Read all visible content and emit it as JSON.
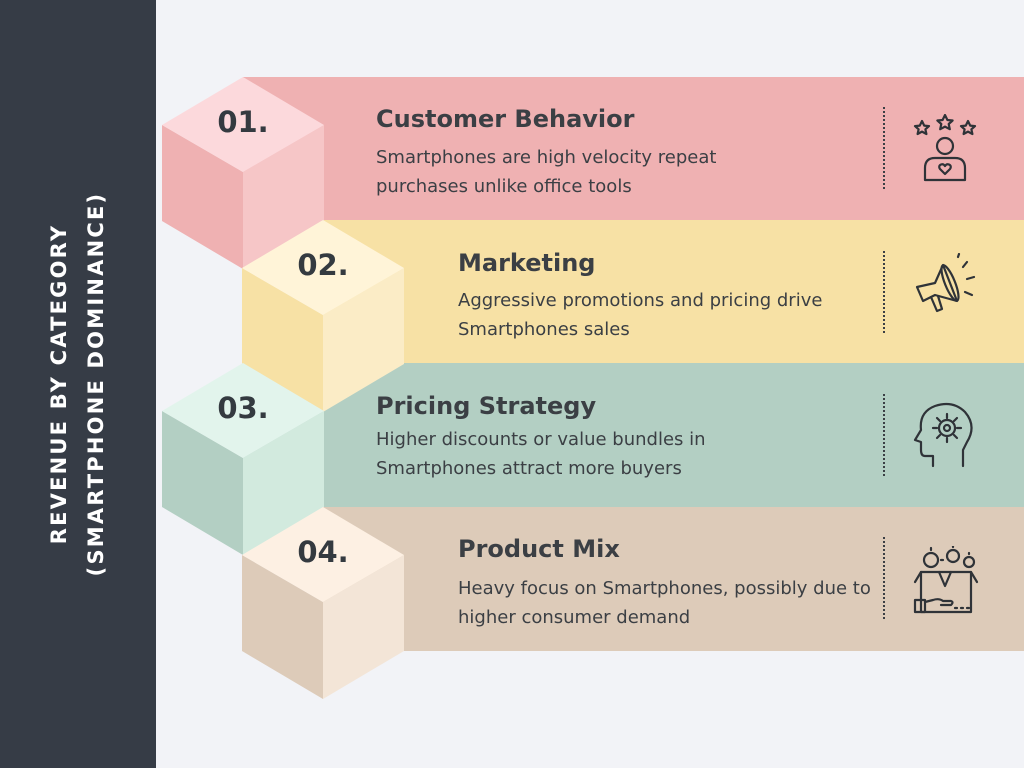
{
  "sidebar": {
    "title_line1": "REVENUE BY CATEGORY",
    "title_line2": "(SMARTPHONE DOMINANCE)"
  },
  "items": [
    {
      "number": "01.",
      "title": "Customer Behavior",
      "description": "Smartphones are high velocity repeat purchases unlike office tools",
      "icon": "customer-rating-icon",
      "band_color": "#efb1b2",
      "cube_top": "#fcd9dc",
      "cube_left": "#efb1b2",
      "cube_right": "#f6c6c7"
    },
    {
      "number": "02.",
      "title": "Marketing",
      "description": "Aggressive promotions and pricing drive Smartphones sales",
      "icon": "megaphone-icon",
      "band_color": "#f7e1a5",
      "cube_top": "#fff4d8",
      "cube_left": "#f7e1a5",
      "cube_right": "#fbecc6"
    },
    {
      "number": "03.",
      "title": "Pricing Strategy",
      "description": "Higher discounts or value bundles in Smartphones attract more buyers",
      "icon": "head-gear-icon",
      "band_color": "#b3cfc3",
      "cube_top": "#e2f4ec",
      "cube_left": "#b3cfc3",
      "cube_right": "#d2eade"
    },
    {
      "number": "04.",
      "title": "Product Mix",
      "description": "Heavy focus on Smartphones, possibly due to higher consumer demand",
      "icon": "product-box-icon",
      "band_color": "#ddcbb9",
      "cube_top": "#fdf0e3",
      "cube_left": "#ddcbb9",
      "cube_right": "#f3e5d7"
    }
  ]
}
